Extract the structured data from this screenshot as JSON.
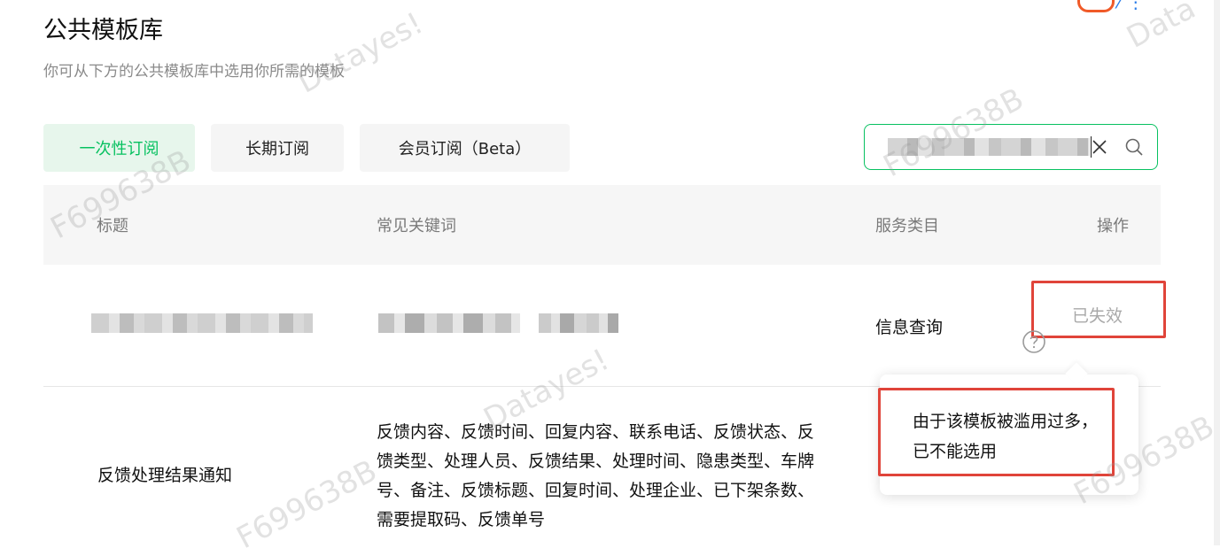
{
  "page": {
    "title": "公共模板库",
    "subtitle": "你可从下方的公共模板库中选用你所需的模板"
  },
  "tabs": [
    {
      "label": "一次性订阅",
      "active": true
    },
    {
      "label": "长期订阅",
      "active": false
    },
    {
      "label": "会员订阅（Beta）",
      "active": false
    }
  ],
  "search": {
    "value_redacted": true,
    "clear_icon": "close-icon",
    "search_icon": "search-icon"
  },
  "table": {
    "headers": {
      "title": "标题",
      "keywords": "常见关键词",
      "category": "服务类目",
      "action": "操作"
    },
    "rows": [
      {
        "title_redacted": true,
        "keywords_redacted": true,
        "category": "信息查询",
        "status": "已失效",
        "status_icon": "help-circle-icon"
      },
      {
        "title": "反馈处理结果通知",
        "keywords_lines": [
          "反馈内容、反馈时间、回复内容、联系电话、反馈状态、反",
          "馈类型、处理人员、反馈结果、处理时间、隐患类型、车牌",
          "号、备注、反馈标题、回复时间、处理企业、已下架条数、",
          "需要提取码、反馈单号"
        ]
      }
    ]
  },
  "tooltip": {
    "text": "由于该模板被滥用过多，已不能选用"
  },
  "watermarks": [
    "Datayes!",
    "F699638B",
    "F699638B",
    "Datayes!",
    "F699638B",
    "F699638B",
    "Data"
  ],
  "colors": {
    "accent": "#07c160",
    "accent_bg": "#e7f6ec",
    "highlight_red": "#e0443a",
    "header_bg": "#f6f6f6",
    "muted_text": "#8a8a8a"
  }
}
